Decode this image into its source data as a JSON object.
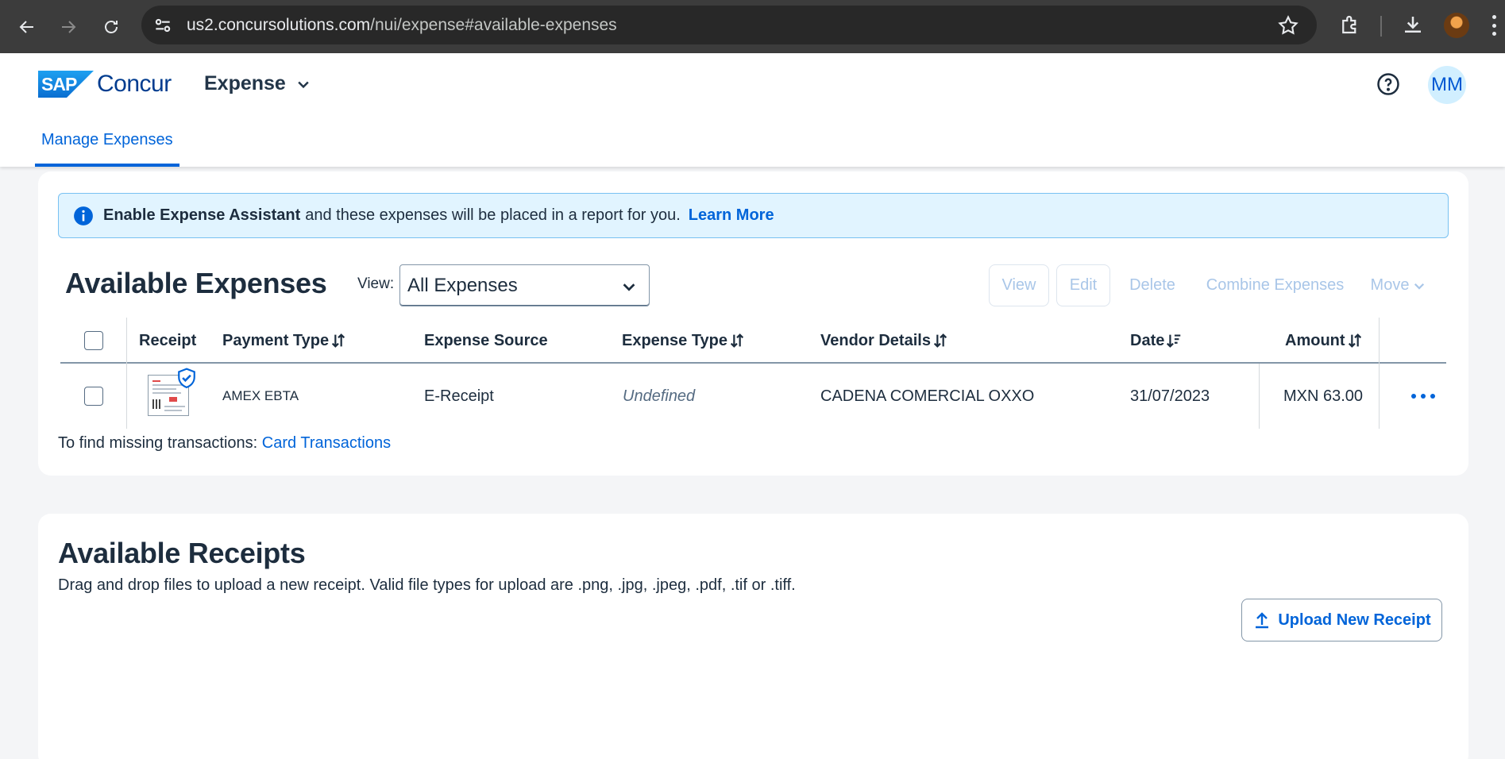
{
  "browser": {
    "url_host": "us2.concursolutions.com",
    "url_path": "/nui/expense#available-expenses"
  },
  "header": {
    "logo_sap": "SAP",
    "logo_concur": "Concur",
    "product": "Expense",
    "user_initials": "MM",
    "tab_active": "Manage Expenses"
  },
  "banner": {
    "strong": "Enable Expense Assistant",
    "text": "and these expenses will be placed in a report for you.",
    "link": "Learn More"
  },
  "expenses": {
    "title": "Available Expenses",
    "view_label": "View:",
    "view_value": "All Expenses",
    "toolbar": {
      "view": "View",
      "edit": "Edit",
      "delete": "Delete",
      "combine": "Combine Expenses",
      "move": "Move"
    },
    "columns": {
      "receipt": "Receipt",
      "payment_type": "Payment Type",
      "expense_source": "Expense Source",
      "expense_type": "Expense Type",
      "vendor_details": "Vendor Details",
      "date": "Date",
      "amount": "Amount"
    },
    "rows": [
      {
        "payment_type": "AMEX EBTA",
        "expense_source": "E-Receipt",
        "expense_type": "Undefined",
        "vendor": "CADENA COMERCIAL OXXO",
        "date": "31/07/2023",
        "amount": "MXN 63.00"
      }
    ],
    "missing_text": "To find missing transactions:",
    "missing_link": "Card Transactions"
  },
  "receipts": {
    "title": "Available Receipts",
    "description": "Drag and drop files to upload a new receipt. Valid file types for upload are .png, .jpg, .jpeg, .pdf, .tif or .tiff.",
    "upload_label": "Upload New Receipt"
  },
  "colors": {
    "brand_blue": "#0064d9",
    "banner_bg": "#e1f4ff",
    "disabled_text": "#a9c6e8",
    "avatar_bg": "#d1efff"
  }
}
